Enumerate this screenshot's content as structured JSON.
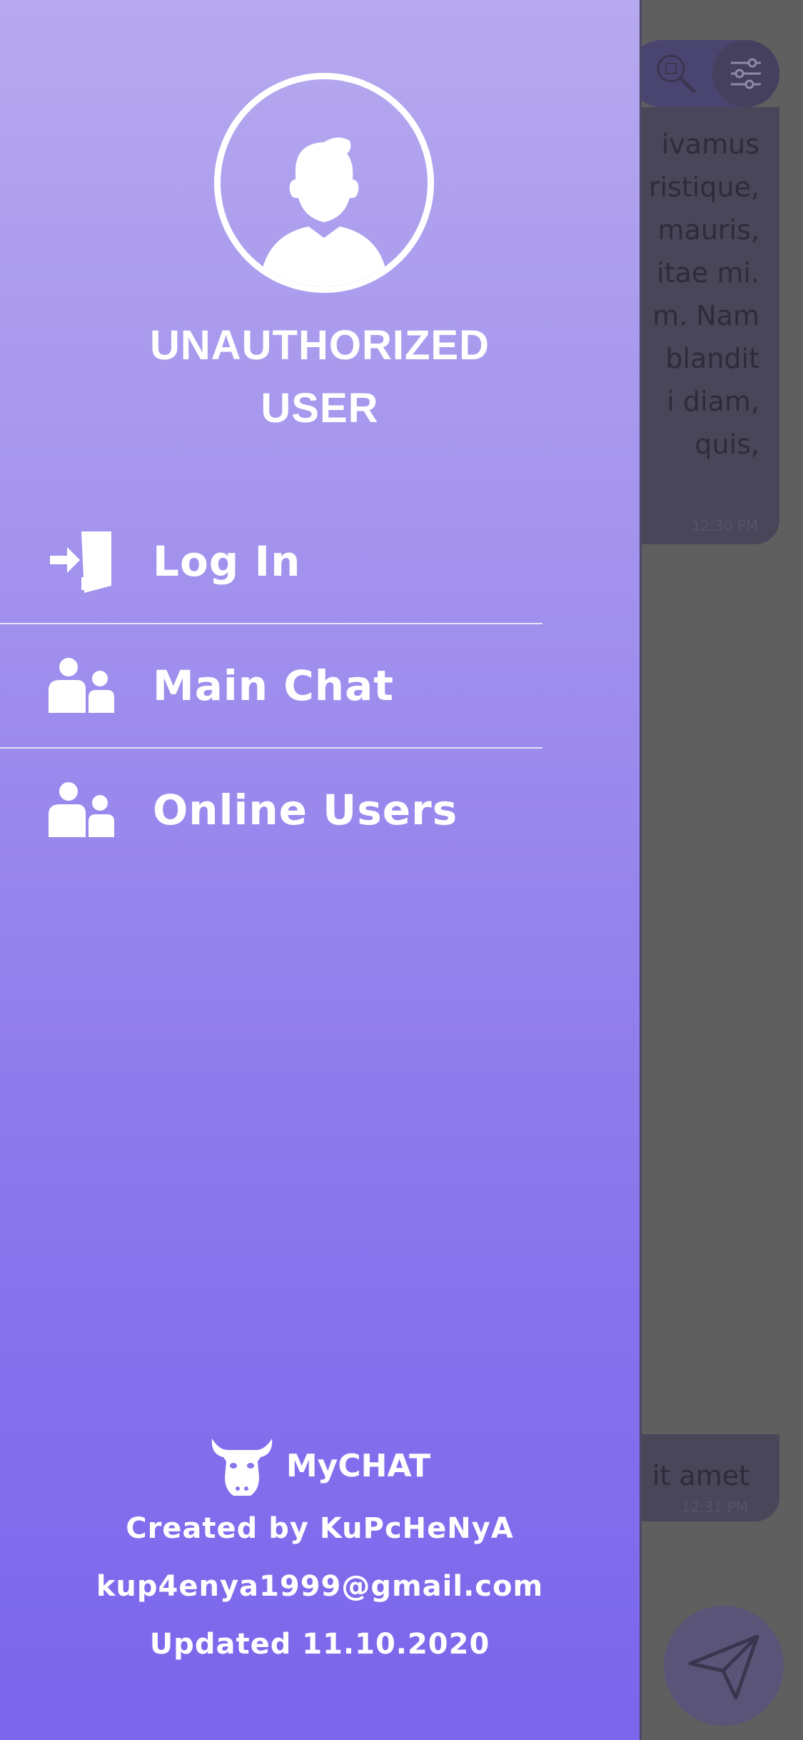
{
  "colors": {
    "drawer_top": "#b6a8ee",
    "drawer_bottom": "#7b66ec",
    "overlay": "#5f5f5f",
    "text": "#ffffff"
  },
  "drawer": {
    "avatar_icon": "user-avatar-icon",
    "user_title_line1": "UNAUTHORIZED",
    "user_title_line2": "USER",
    "menu": [
      {
        "label": "Log In",
        "icon": "login-icon"
      },
      {
        "label": "Main Chat",
        "icon": "users-icon"
      },
      {
        "label": "Online Users",
        "icon": "users-icon"
      }
    ],
    "footer": {
      "brand": "MyCHAT",
      "brand_icon": "cow-logo-icon",
      "created_by": "Created by KuPcHeNyA",
      "email": "kup4enya1999@gmail.com",
      "updated": "Updated 11.10.2020"
    }
  },
  "chat": {
    "search_icon": "search-icon",
    "settings_icon": "settings-sliders-icon",
    "messages": [
      {
        "text": "ivamus\nristique,\nmauris,\nitae mi.\nm. Nam\nblandit\ni diam,\nquis,",
        "time": "12:30 PM"
      },
      {
        "text": "it amet",
        "time": "12:31 PM"
      }
    ],
    "send_icon": "send-icon"
  }
}
